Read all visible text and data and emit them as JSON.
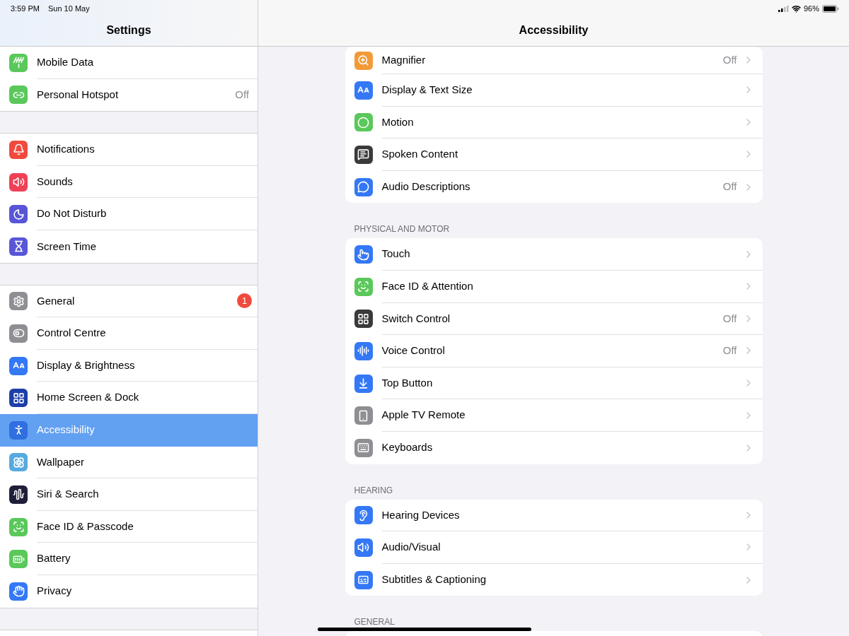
{
  "status_bar": {
    "time": "3:59 PM",
    "date": "Sun 10 May",
    "battery": "96%"
  },
  "sidebar": {
    "title": "Settings",
    "groups": [
      [
        {
          "label": "Mobile Data",
          "selected": false
        },
        {
          "label": "Personal Hotspot",
          "value": "Off",
          "selected": false
        }
      ],
      [
        {
          "label": "Notifications",
          "selected": false
        },
        {
          "label": "Sounds",
          "selected": false
        },
        {
          "label": "Do Not Disturb",
          "selected": false
        },
        {
          "label": "Screen Time",
          "selected": false
        }
      ],
      [
        {
          "label": "General",
          "badge": "1",
          "selected": false
        },
        {
          "label": "Control Centre",
          "selected": false
        },
        {
          "label": "Display & Brightness",
          "selected": false
        },
        {
          "label": "Home Screen & Dock",
          "selected": false
        },
        {
          "label": "Accessibility",
          "selected": true
        },
        {
          "label": "Wallpaper",
          "selected": false
        },
        {
          "label": "Siri & Search",
          "selected": false
        },
        {
          "label": "Face ID & Passcode",
          "selected": false
        },
        {
          "label": "Battery",
          "selected": false
        },
        {
          "label": "Privacy",
          "selected": false
        }
      ]
    ]
  },
  "detail": {
    "title": "Accessibility",
    "sections": [
      {
        "rows": [
          {
            "label": "Magnifier",
            "value": "Off"
          },
          {
            "label": "Display & Text Size"
          },
          {
            "label": "Motion"
          },
          {
            "label": "Spoken Content"
          },
          {
            "label": "Audio Descriptions",
            "value": "Off"
          }
        ]
      },
      {
        "header": "PHYSICAL AND MOTOR",
        "rows": [
          {
            "label": "Touch"
          },
          {
            "label": "Face ID & Attention"
          },
          {
            "label": "Switch Control",
            "value": "Off"
          },
          {
            "label": "Voice Control",
            "value": "Off"
          },
          {
            "label": "Top Button"
          },
          {
            "label": "Apple TV Remote"
          },
          {
            "label": "Keyboards"
          }
        ]
      },
      {
        "header": "HEARING",
        "rows": [
          {
            "label": "Hearing Devices"
          },
          {
            "label": "Audio/Visual"
          },
          {
            "label": "Subtitles & Captioning"
          }
        ]
      },
      {
        "header": "GENERAL"
      }
    ]
  }
}
